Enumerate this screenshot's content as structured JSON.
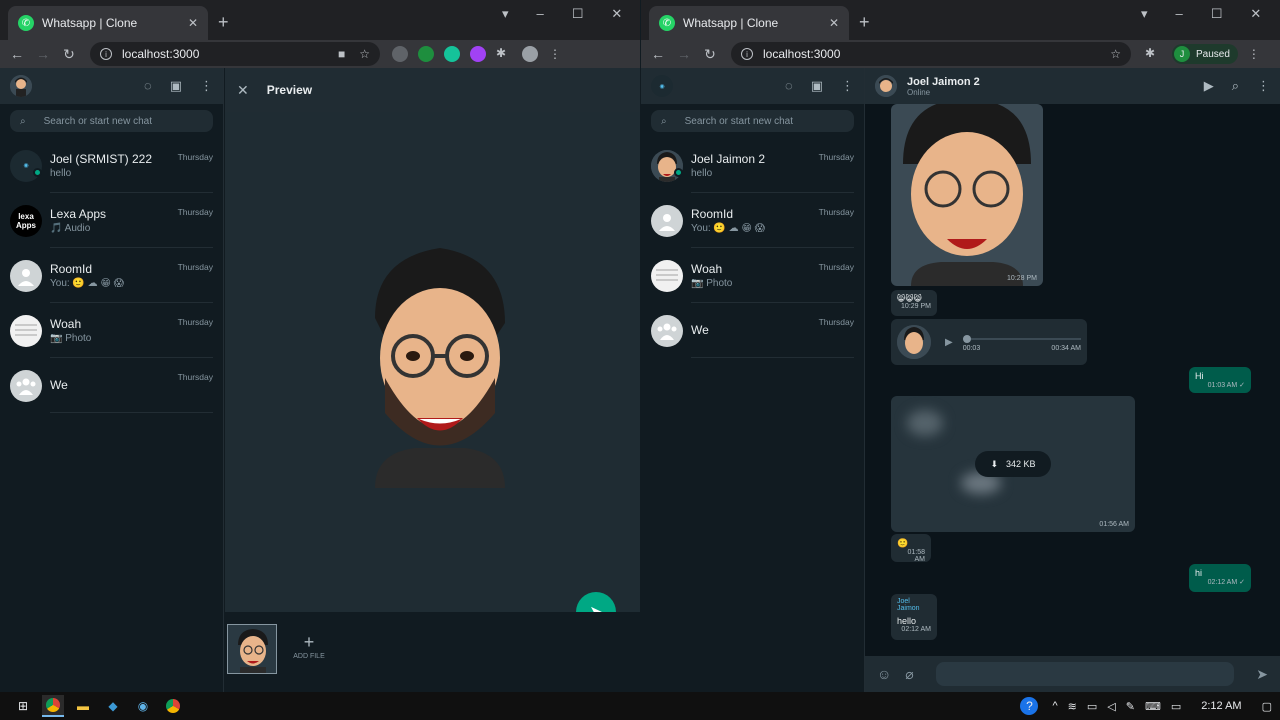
{
  "browser": {
    "tab_title": "Whatsapp | Clone",
    "url": "localhost:3000",
    "profile_status": "Paused",
    "profile_initial": "J"
  },
  "left": {
    "search_placeholder": "Search or start new chat",
    "chats": [
      {
        "name": "Joel (SRMIST) 222",
        "last": "hello",
        "time": "Thursday"
      },
      {
        "name": "Lexa Apps",
        "last": "🎵 Audio",
        "time": "Thursday",
        "avatar_text": "lexa Apps"
      },
      {
        "name": "RoomId",
        "last": "You: 🙂 ☁ 😁 😱",
        "time": "Thursday"
      },
      {
        "name": "Woah",
        "last": "📷 Photo",
        "time": "Thursday"
      },
      {
        "name": "We",
        "last": "",
        "time": "Thursday"
      }
    ],
    "preview": {
      "title": "Preview",
      "add_file": "ADD FILE"
    }
  },
  "right": {
    "search_placeholder": "Search or start new chat",
    "chats": [
      {
        "name": "Joel Jaimon 2",
        "last": "hello",
        "time": "Thursday"
      },
      {
        "name": "RoomId",
        "last": "You: 🙂 ☁ 😁 😱",
        "time": "Thursday"
      },
      {
        "name": "Woah",
        "last": "📷 Photo",
        "time": "Thursday"
      },
      {
        "name": "We",
        "last": "",
        "time": "Thursday"
      }
    ],
    "conversation": {
      "contact_name": "Joel Jaimon 2",
      "status": "Online",
      "messages": {
        "img1_time": "10:28 PM",
        "emoji_msg": "😸😸😸",
        "emoji_time": "10:29 PM",
        "audio_start": "00:03",
        "audio_end": "00:34 AM",
        "hi1": "Hi",
        "hi1_time": "01:03 AM",
        "file_size": "342 KB",
        "file_time": "01:56 AM",
        "smile": "🙂",
        "smile_time": "01:58 AM",
        "hi2": "hi",
        "hi2_time": "02:12 AM",
        "sender": "Joel Jaimon",
        "hello": "hello",
        "hello_time": "02:12 AM"
      }
    }
  },
  "taskbar": {
    "clock": "2:12 AM"
  }
}
